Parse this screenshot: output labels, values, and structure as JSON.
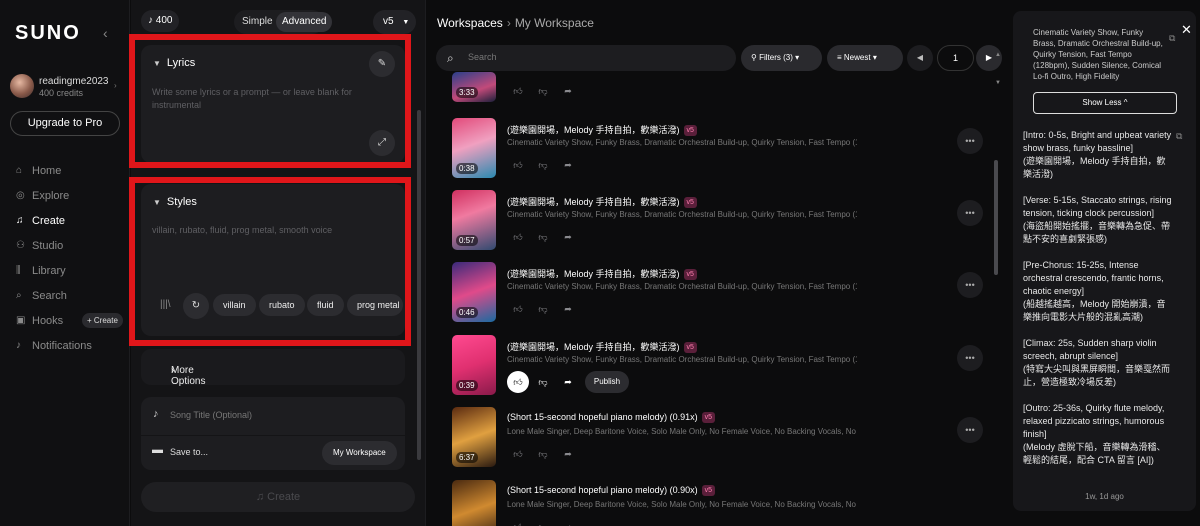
{
  "brand": "SUNO",
  "user": {
    "name": "readingme2023",
    "credits": "400 credits"
  },
  "upgrade_label": "Upgrade to Pro",
  "nav": [
    {
      "label": "Home",
      "icon": "home-icon",
      "glyph": "⌂"
    },
    {
      "label": "Explore",
      "icon": "compass-icon",
      "glyph": "◎"
    },
    {
      "label": "Create",
      "icon": "music-note-icon",
      "glyph": "♫"
    },
    {
      "label": "Studio",
      "icon": "studio-icon",
      "glyph": "⚇"
    },
    {
      "label": "Library",
      "icon": "library-icon",
      "glyph": "⫼"
    },
    {
      "label": "Search",
      "icon": "search-icon",
      "glyph": "⌕"
    },
    {
      "label": "Hooks",
      "icon": "hooks-icon",
      "glyph": "▣"
    },
    {
      "label": "Notifications",
      "icon": "bell-icon",
      "glyph": "♪"
    }
  ],
  "nav_active": "Create",
  "hooks_create_label": "+ Create",
  "create": {
    "credits": "400",
    "mode_simple": "Simple",
    "mode_advanced": "Advanced",
    "version": "v5",
    "lyrics_title": "Lyrics",
    "lyrics_placeholder": "Write some lyrics or a prompt — or leave blank for instrumental",
    "styles_title": "Styles",
    "styles_placeholder": "villain, rubato, fluid, prog metal, smooth voice",
    "style_tags": [
      "villain",
      "rubato",
      "fluid",
      "prog metal"
    ],
    "more_options": "More Options",
    "song_title_placeholder": "Song Title (Optional)",
    "save_to": "Save to...",
    "workspace_button": "My Workspace",
    "create_button": "Create"
  },
  "workspace": {
    "crumb_root": "Workspaces",
    "crumb_current": "My Workspace",
    "search_placeholder": "Search",
    "filters_label": "Filters (3)",
    "sort_label": "Newest",
    "page": "1",
    "publish_label": "Publish",
    "songs": [
      {
        "title": "",
        "tags": "",
        "duration": "3:33",
        "version": ""
      },
      {
        "title": "(遊樂園開場，Melody 手持自拍，歡樂活潑)",
        "tags": "Cinematic Variety Show, Funky Brass, Dramatic Orchestral Build-up, Quirky Tension, Fast Tempo (128bp...",
        "duration": "0:38",
        "version": "v5"
      },
      {
        "title": "(遊樂園開場，Melody 手持自拍，歡樂活潑)",
        "tags": "Cinematic Variety Show, Funky Brass, Dramatic Orchestral Build-up, Quirky Tension, Fast Tempo (128bp...",
        "duration": "0:57",
        "version": "v5"
      },
      {
        "title": "(遊樂園開場，Melody 手持自拍，歡樂活潑)",
        "tags": "Cinematic Variety Show, Funky Brass, Dramatic Orchestral Build-up, Quirky Tension, Fast Tempo (128bp...",
        "duration": "0:46",
        "version": "v5"
      },
      {
        "title": "(遊樂園開場，Melody 手持自拍，歡樂活潑)",
        "tags": "Cinematic Variety Show, Funky Brass, Dramatic Orchestral Build-up, Quirky Tension, Fast Tempo (128bp...",
        "duration": "0:39",
        "version": "v5"
      },
      {
        "title": "(Short 15-second hopeful piano melody) (0.91x)",
        "tags": "Lone Male Singer, Deep Baritone Voice, Solo Male Only, No Female Voice, No Backing Vocals, No Harmo...",
        "duration": "6:37",
        "version": "v5"
      },
      {
        "title": "(Short 15-second hopeful piano melody) (0.90x)",
        "tags": "Lone Male Singer, Deep Baritone Voice, Solo Male Only, No Female Voice, No Backing Vocals, No Harmo...",
        "duration": "",
        "version": "v5"
      }
    ]
  },
  "detail": {
    "style_text": "Cinematic Variety Show, Funky Brass, Dramatic Orchestral Build-up, Quirky Tension, Fast Tempo (128bpm), Sudden Silence, Comical Lo-fi Outro, High Fidelity",
    "show_less": "Show Less",
    "lyrics": [
      "[Intro: 0-5s, Bright and upbeat variety show brass, funky bassline]\n(遊樂園開場，Melody 手持自拍，歡樂活潑)",
      "[Verse: 5-15s, Staccato strings, rising tension, ticking clock percussion]\n(海盜船開始搖擺，音樂轉為急促、帶點不安的喜劇緊張感)",
      "[Pre-Chorus: 15-25s, Intense orchestral crescendo, frantic horns, chaotic energy]\n(船越搖越高，Melody 開始崩潰，音樂推向電影大片般的混亂高潮)",
      "[Climax: 25s, Sudden sharp violin screech, abrupt silence]\n(特寫大尖叫與黑屏瞬間，音樂戛然而止，營造極致冷場反差)",
      "[Outro: 25-36s, Quirky flute melody, relaxed pizzicato strings, humorous finish]\n(Melody 虛脫下船，音樂轉為滑稽、輕鬆的結尾，配合 CTA 留言 [AI])"
    ],
    "age": "1w, 1d ago"
  },
  "colors": {
    "highlight": "#e0161a",
    "badge": "#ff7fb0"
  }
}
